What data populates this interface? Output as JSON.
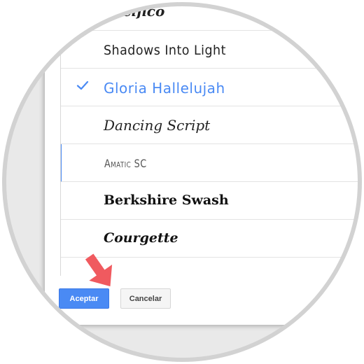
{
  "font_picker": {
    "fonts": [
      {
        "name": "Pacifico",
        "selected": false
      },
      {
        "name": "Shadows Into Light",
        "selected": false
      },
      {
        "name": "Gloria Hallelujah",
        "selected": true
      },
      {
        "name": "Dancing Script",
        "selected": false
      },
      {
        "name": "Amatic SC",
        "selected": false
      },
      {
        "name": "Berkshire Swash",
        "selected": false
      },
      {
        "name": "Courgette",
        "selected": false
      }
    ]
  },
  "actions": {
    "accept_label": "Aceptar",
    "cancel_label": "Cancelar"
  },
  "colors": {
    "accent": "#4a8af4",
    "arrow": "#f05a5f"
  }
}
